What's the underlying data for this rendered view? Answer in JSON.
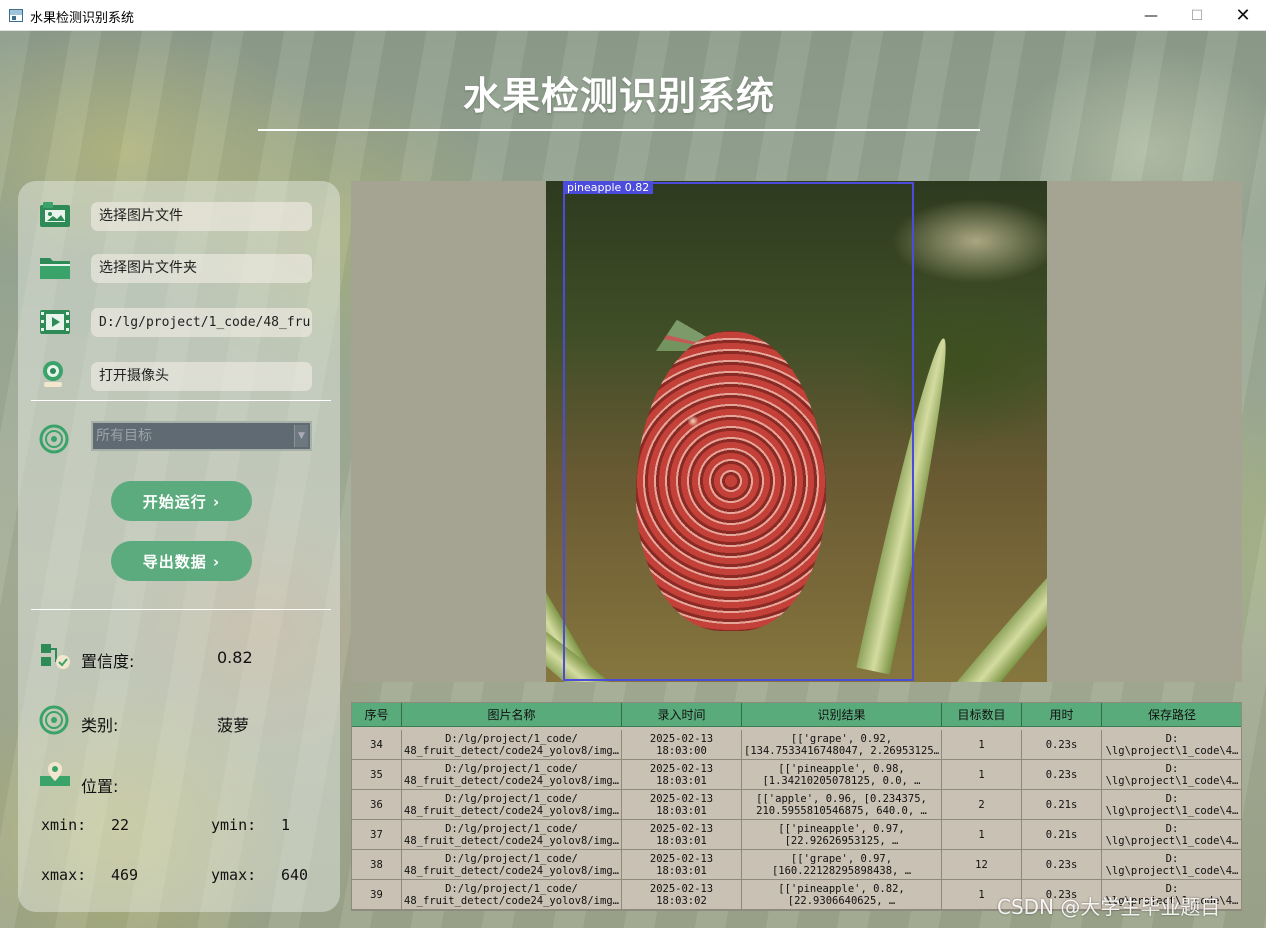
{
  "window": {
    "title": "水果检测识别系统",
    "minimize": "—",
    "maximize": "☐",
    "close": "✕"
  },
  "header": {
    "title": "水果检测识别系统"
  },
  "sidebar": {
    "select_image_file": "选择图片文件",
    "select_image_folder": "选择图片文件夹",
    "video_path": "D:/lg/project/1_code/48_fru",
    "open_camera": "打开摄像头",
    "target_select": "所有目标",
    "start_button": "开始运行 ›",
    "export_button": "导出数据 ›",
    "confidence_label": "置信度:",
    "confidence_value": "0.82",
    "class_label": "类别:",
    "class_value": "菠萝",
    "position_label": "位置:",
    "xmin_label": "xmin:",
    "xmin_value": "22",
    "ymin_label": "ymin:",
    "ymin_value": "1",
    "xmax_label": "xmax:",
    "xmax_value": "469",
    "ymax_label": "ymax:",
    "ymax_value": "640"
  },
  "detection": {
    "label": "pineapple 0.82",
    "box_color": "#4b4bdc"
  },
  "table": {
    "headers": [
      "序号",
      "图片名称",
      "录入时间",
      "识别结果",
      "目标数目",
      "用时",
      "保存路径"
    ],
    "rows": [
      {
        "id": "34",
        "name1": "D:/lg/project/1_code/",
        "name2": "48_fruit_detect/code24_yolov8/img…",
        "time1": "2025-02-13",
        "time2": "18:03:00",
        "res1": "[['grape', 0.92,",
        "res2": "[134.7533416748047, 2.26953125…",
        "count": "1",
        "dur": "0.23s",
        "path1": "D:",
        "path2": "\\lg\\project\\1_code\\4…"
      },
      {
        "id": "35",
        "name1": "D:/lg/project/1_code/",
        "name2": "48_fruit_detect/code24_yolov8/img…",
        "time1": "2025-02-13",
        "time2": "18:03:01",
        "res1": "[['pineapple', 0.98,",
        "res2": "[1.34210205078125, 0.0, …",
        "count": "1",
        "dur": "0.23s",
        "path1": "D:",
        "path2": "\\lg\\project\\1_code\\4…"
      },
      {
        "id": "36",
        "name1": "D:/lg/project/1_code/",
        "name2": "48_fruit_detect/code24_yolov8/img…",
        "time1": "2025-02-13",
        "time2": "18:03:01",
        "res1": "[['apple', 0.96, [0.234375,",
        "res2": "210.5955810546875, 640.0, …",
        "count": "2",
        "dur": "0.21s",
        "path1": "D:",
        "path2": "\\lg\\project\\1_code\\4…"
      },
      {
        "id": "37",
        "name1": "D:/lg/project/1_code/",
        "name2": "48_fruit_detect/code24_yolov8/img…",
        "time1": "2025-02-13",
        "time2": "18:03:01",
        "res1": "[['pineapple', 0.97,",
        "res2": "[22.92626953125, …",
        "count": "1",
        "dur": "0.21s",
        "path1": "D:",
        "path2": "\\lg\\project\\1_code\\4…"
      },
      {
        "id": "38",
        "name1": "D:/lg/project/1_code/",
        "name2": "48_fruit_detect/code24_yolov8/img…",
        "time1": "2025-02-13",
        "time2": "18:03:01",
        "res1": "[['grape', 0.97,",
        "res2": "[160.22128295898438, …",
        "count": "12",
        "dur": "0.23s",
        "path1": "D:",
        "path2": "\\lg\\project\\1_code\\4…"
      },
      {
        "id": "39",
        "name1": "D:/lg/project/1_code/",
        "name2": "48_fruit_detect/code24_yolov8/img…",
        "time1": "2025-02-13",
        "time2": "18:03:02",
        "res1": "[['pineapple', 0.82,",
        "res2": "[22.9306640625, …",
        "count": "1",
        "dur": "0.23s",
        "path1": "D:",
        "path2": "\\lg\\project\\1_code\\4…"
      }
    ]
  },
  "watermark": "CSDN @大学生毕业题目"
}
